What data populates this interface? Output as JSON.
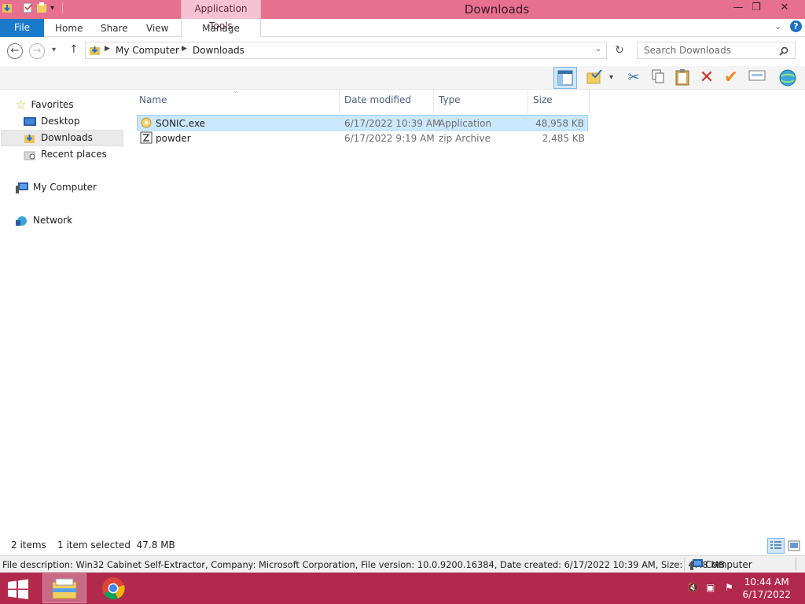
{
  "window": {
    "title": "Downloads",
    "minimize_glyph": "—",
    "restore_glyph": "❐",
    "close_glyph": "✕"
  },
  "ribbon": {
    "file_tab": "File",
    "tabs": [
      "Home",
      "Share",
      "View"
    ],
    "contextual_group": "Application Tools",
    "contextual_tab": "Manage"
  },
  "address": {
    "breadcrumb": [
      "My Computer",
      "Downloads"
    ],
    "search_placeholder": "Search Downloads"
  },
  "nav": {
    "favorites_label": "Favorites",
    "favorites": [
      "Desktop",
      "Downloads",
      "Recent places"
    ],
    "computer_label": "My Computer",
    "network_label": "Network"
  },
  "columns": {
    "name": "Name",
    "date": "Date modified",
    "type": "Type",
    "size": "Size"
  },
  "files": [
    {
      "name": "SONIC.exe",
      "date": "6/17/2022 10:39 AM",
      "type": "Application",
      "size": "48,958 KB",
      "selected": true
    },
    {
      "name": "powder",
      "date": "6/17/2022 9:19 AM",
      "type": "zip Archive",
      "size": "2,485 KB",
      "selected": false
    }
  ],
  "status": {
    "item_count": "2 items",
    "selection": "1 item selected  47.8 MB"
  },
  "details": {
    "text": "File description: Win32 Cabinet Self-Extractor, Company: Microsoft Corporation, File version: 10.0.9200.16384, Date created: 6/17/2022 10:39 AM, Size:  47.8 MB",
    "location": "Computer"
  },
  "taskbar": {
    "time": "10:44 AM",
    "date": "6/17/2022"
  },
  "colors": {
    "titlebar": "#e8708f",
    "taskbar": "#b1294c",
    "file_tab": "#1979ca",
    "selection": "#cce8ff"
  }
}
